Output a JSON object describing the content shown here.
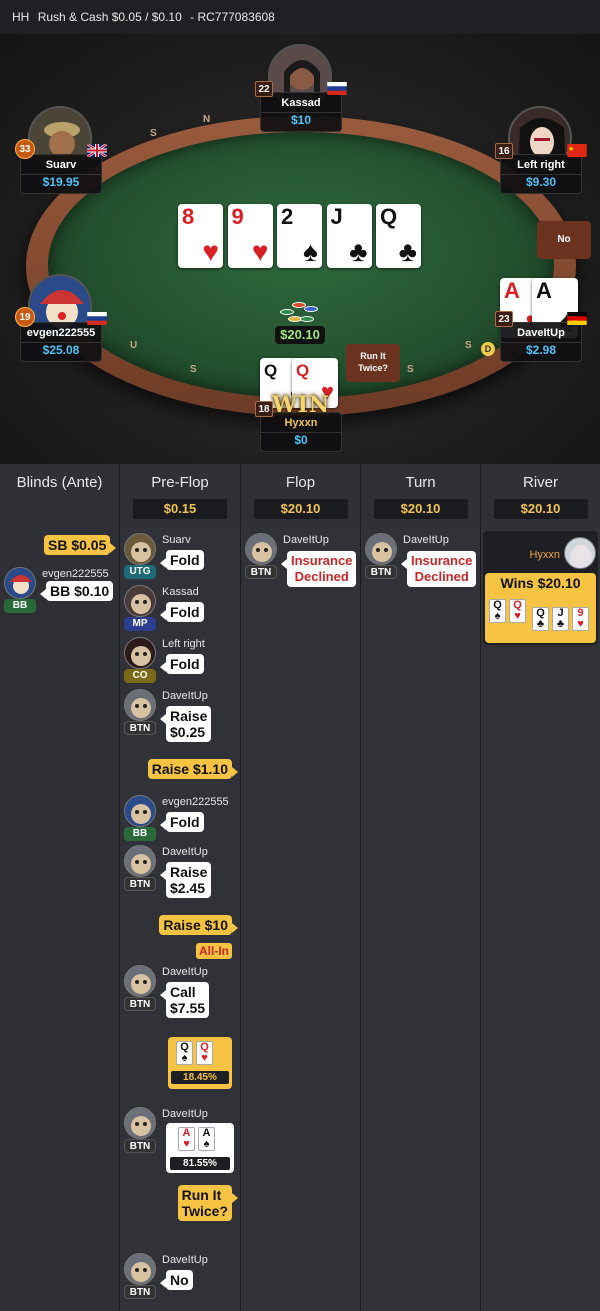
{
  "header": {
    "prefix": "HH",
    "game": "Rush & Cash $0.05 / $0.10",
    "hand_id": "- RC777083608"
  },
  "table": {
    "rail_letters": [
      "S",
      "N",
      "U",
      "S",
      "S",
      "S"
    ],
    "board": [
      {
        "rank": "8",
        "suit": "♥",
        "color": "red"
      },
      {
        "rank": "9",
        "suit": "♥",
        "color": "red"
      },
      {
        "rank": "2",
        "suit": "♠",
        "color": "blk"
      },
      {
        "rank": "J",
        "suit": "♣",
        "color": "blk"
      },
      {
        "rank": "Q",
        "suit": "♣",
        "color": "blk"
      }
    ],
    "pot": "$20.10",
    "seats": {
      "kassad": {
        "name": "Kassad",
        "stack": "$10",
        "level": "22"
      },
      "suarv": {
        "name": "Suarv",
        "stack": "$19.95",
        "level": "33"
      },
      "left_right": {
        "name": "Left right",
        "stack": "$9.30",
        "level": "16"
      },
      "evgen": {
        "name": "evgen222555",
        "stack": "$25.08",
        "level": "19"
      },
      "daveitup": {
        "name": "DaveItUp",
        "stack": "$2.98",
        "level": "23"
      },
      "hyxxn": {
        "name": "Hyxxn",
        "stack": "$0",
        "level": "18"
      }
    },
    "daveitup_cards": [
      {
        "rank": "A",
        "suit": "♥",
        "color": "red"
      },
      {
        "rank": "A",
        "suit": "♠",
        "color": "blk"
      }
    ],
    "hyxxn_cards": [
      {
        "rank": "Q",
        "suit": "♠",
        "color": "blk"
      },
      {
        "rank": "Q",
        "suit": "♥",
        "color": "red"
      }
    ],
    "no_button": "No",
    "run_it_twice_button": "Run It Twice?",
    "win_badge": "WIN",
    "dealer_label": "D"
  },
  "history": {
    "columns": [
      {
        "title": "Blinds (Ante)",
        "pot": ""
      },
      {
        "title": "Pre-Flop",
        "pot": "$0.15"
      },
      {
        "title": "Flop",
        "pot": "$20.10"
      },
      {
        "title": "Turn",
        "pot": "$20.10"
      },
      {
        "title": "River",
        "pot": "$20.10"
      }
    ],
    "blinds": {
      "sb": "SB $0.05",
      "bb_player": "evgen222555",
      "bb_pos": "BB",
      "bb": "BB $0.10"
    },
    "preflop": [
      {
        "player": "Suarv",
        "pos": "UTG",
        "action": "Fold"
      },
      {
        "player": "Kassad",
        "pos": "MP",
        "action": "Fold"
      },
      {
        "player": "Left right",
        "pos": "CO",
        "action": "Fold"
      },
      {
        "player": "DaveItUp",
        "pos": "BTN",
        "action": "Raise\n$0.25"
      },
      {
        "hero_action": "Raise $1.10"
      },
      {
        "player": "evgen222555",
        "pos": "BB",
        "action": "Fold"
      },
      {
        "player": "DaveItUp",
        "pos": "BTN",
        "action": "Raise\n$2.45"
      },
      {
        "hero_action": "Raise $10",
        "allin": "All-In"
      },
      {
        "player": "DaveItUp",
        "pos": "BTN",
        "action": "Call\n$7.55"
      },
      {
        "hero_equity": "18.45%"
      },
      {
        "player": "DaveItUp",
        "pos": "BTN",
        "equity": "81.55%"
      },
      {
        "hero_action": "Run It\nTwice?"
      },
      {
        "player": "DaveItUp",
        "pos": "BTN",
        "action": "No"
      }
    ],
    "flop": {
      "player": "DaveItUp",
      "pos": "BTN",
      "action": "Insurance\nDeclined"
    },
    "turn": {
      "player": "DaveItUp",
      "pos": "BTN",
      "action": "Insurance\nDeclined"
    },
    "river": {
      "player": "Hyxxn",
      "wins": "Wins $20.10",
      "hole": [
        {
          "rank": "Q",
          "suit": "♠",
          "color": "blk"
        },
        {
          "rank": "Q",
          "suit": "♥",
          "color": "red"
        }
      ],
      "board": [
        {
          "rank": "Q",
          "suit": "♣",
          "color": "blk"
        },
        {
          "rank": "J",
          "suit": "♣",
          "color": "blk"
        },
        {
          "rank": "9",
          "suit": "♥",
          "color": "red"
        }
      ]
    }
  }
}
